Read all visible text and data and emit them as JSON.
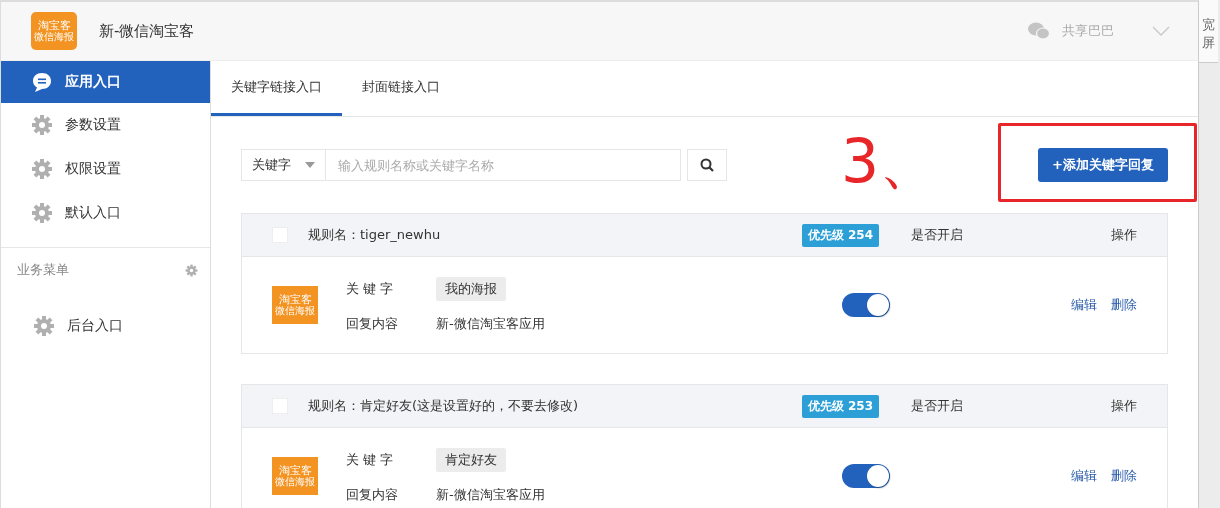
{
  "header": {
    "logo": {
      "line_1": "淘宝客",
      "line_2": "微信海报"
    },
    "title": "新-微信淘宝客",
    "user": "共享巴巴"
  },
  "side_strip": {
    "label": "宽屏"
  },
  "sidebar": {
    "items": [
      {
        "label": "应用入口",
        "kind": "chat",
        "selected": true
      },
      {
        "label": "参数设置",
        "kind": "gear",
        "selected": false
      },
      {
        "label": "权限设置",
        "kind": "gear",
        "selected": false
      },
      {
        "label": "默认入口",
        "kind": "gear",
        "selected": false
      }
    ],
    "section": {
      "title": "业务菜单",
      "items": [
        {
          "label": "后台入口",
          "kind": "gear",
          "selected": false
        }
      ]
    }
  },
  "tabs": [
    {
      "label": "关键字链接入口",
      "selected": true
    },
    {
      "label": "封面链接入口",
      "selected": false
    }
  ],
  "search": {
    "filter": "关键字",
    "placeholder": "输入规则名称或关键字名称"
  },
  "add_button": "+添加关键字回复",
  "annotation": {
    "text": "3、"
  },
  "rules": [
    {
      "name": "规则名：tiger_newhu",
      "checked": false,
      "priority": "优先级 254",
      "enabled_header": "是否开启",
      "actions_header": "操作",
      "logo": {
        "line_1": "淘宝客",
        "line_2": "微信海报"
      },
      "keyword_label": "关 键 字",
      "keyword": "我的海报",
      "reply_label": "回复内容",
      "reply": "新-微信淘宝客应用",
      "on": true,
      "actions": [
        "编辑",
        "删除"
      ]
    },
    {
      "name": "规则名：肯定好友(这是设置好的，不要去修改)",
      "checked": false,
      "priority": "优先级 253",
      "enabled_header": "是否开启",
      "actions_header": "操作",
      "logo": {
        "line_1": "淘宝客",
        "line_2": "微信海报"
      },
      "keyword_label": "关 键 字",
      "keyword": "肯定好友",
      "reply_label": "回复内容",
      "reply": "新-微信淘宝客应用",
      "on": true,
      "actions": [
        "编辑",
        "删除"
      ]
    }
  ]
}
